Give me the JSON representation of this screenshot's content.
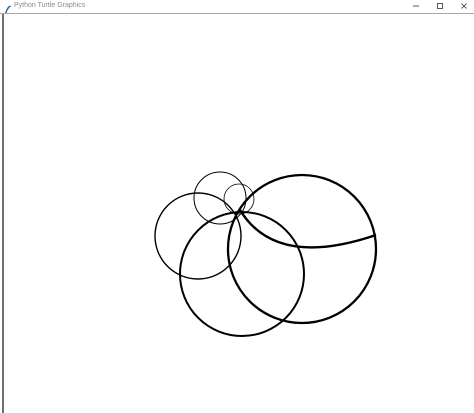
{
  "window": {
    "title": "Python Turtle Graphics",
    "app_icon": "feather-icon",
    "controls": {
      "minimize_icon": "minimize-icon",
      "maximize_icon": "maximize-icon",
      "close_icon": "close-icon"
    }
  },
  "canvas": {
    "background": "#ffffff",
    "stroke_color": "#000000",
    "shapes": [
      "circle",
      "circle",
      "circle",
      "circle",
      "circle",
      "arc"
    ]
  }
}
